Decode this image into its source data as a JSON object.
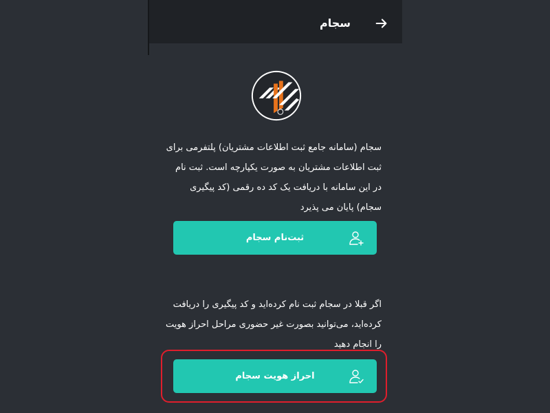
{
  "header": {
    "title": "سجام",
    "back_icon": "arrow-right-icon"
  },
  "logo": {
    "icon": "sejam-logo",
    "colors": {
      "dark": "#23262b",
      "orange": "#e8731c",
      "white": "#ffffff"
    }
  },
  "intro": {
    "lines": [
      "سجام (سامانه جامع ثبت اطلاعات مشتریان) پلتفرمی برای",
      "ثبت اطلاعات مشتریان به صورت یکپارچه است. ثبت نام",
      "در این سامانه با دریافت یک کد ده رقمی (کد پیگیری",
      "سجام) پایان می پذیرد"
    ]
  },
  "register_button": {
    "label": "ثبت‌نام سجام",
    "icon": "user-add-icon"
  },
  "info": {
    "lines": [
      "اگر قبلا در سجام ثبت نام کرده‌اید و کد پیگیری را دریافت",
      "کرده‌اید، می‌توانید بصورت غیر حضوری مراحل احراز هویت",
      "را انجام دهید"
    ]
  },
  "verify_button": {
    "label": "احراز هویت سجام",
    "icon": "user-check-icon"
  },
  "colors": {
    "background": "#2b2f35",
    "header": "#1f2226",
    "accent": "#22c7b1",
    "highlight": "#e01e2c"
  }
}
